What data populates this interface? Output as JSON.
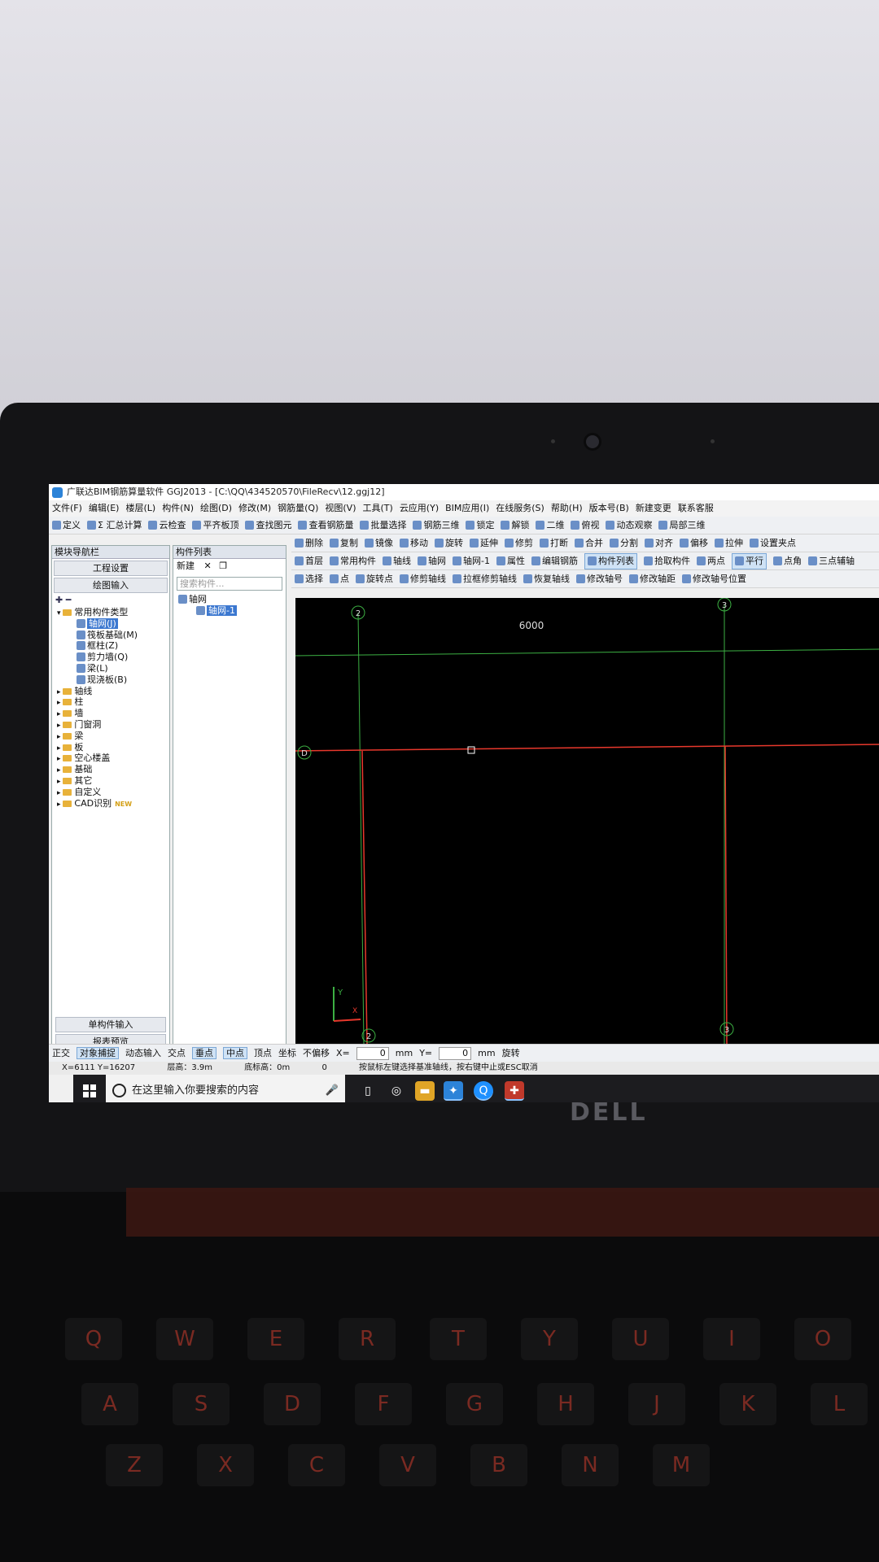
{
  "app": {
    "title": "广联达BIM钢筋算量软件 GGJ2013 - [C:\\QQ\\434520570\\FileRecv\\12.ggj12]"
  },
  "menu": [
    "文件(F)",
    "编辑(E)",
    "楼层(L)",
    "构件(N)",
    "绘图(D)",
    "修改(M)",
    "钢筋量(Q)",
    "视图(V)",
    "工具(T)",
    "云应用(Y)",
    "BIM应用(I)",
    "在线服务(S)",
    "帮助(H)",
    "版本号(B)",
    "新建变更",
    "联系客服"
  ],
  "toolbar1": [
    "定义",
    "Σ 汇总计算",
    "云检查",
    "平齐板顶",
    "查找图元",
    "查看钢筋量",
    "批量选择",
    "钢筋三维",
    "锁定",
    "解锁",
    "二维",
    "俯视",
    "动态观察",
    "局部三维"
  ],
  "toolbar2": [
    "删除",
    "复制",
    "镜像",
    "移动",
    "旋转",
    "延伸",
    "修剪",
    "打断",
    "合并",
    "分割",
    "对齐",
    "偏移",
    "拉伸",
    "设置夹点"
  ],
  "toolbar3": [
    "首层",
    "常用构件",
    "轴线",
    "轴网",
    "轴网-1",
    "属性",
    "编辑钢筋",
    "构件列表",
    "拾取构件",
    "两点",
    "平行",
    "点角",
    "三点辅轴"
  ],
  "toolbar4": [
    "选择",
    "点",
    "旋转点",
    "修剪轴线",
    "拉框修剪轴线",
    "恢复轴线",
    "修改轴号",
    "修改轴距",
    "修改轴号位置"
  ],
  "nav_panel": {
    "title": "模块导航栏",
    "buttons": [
      "工程设置",
      "绘图输入"
    ],
    "tree": [
      {
        "label": "常用构件类型",
        "level": 0,
        "type": "folder"
      },
      {
        "label": "轴网(J)",
        "level": 1,
        "type": "item",
        "selected": true
      },
      {
        "label": "筏板基础(M)",
        "level": 1,
        "type": "item"
      },
      {
        "label": "框柱(Z)",
        "level": 1,
        "type": "item"
      },
      {
        "label": "剪力墙(Q)",
        "level": 1,
        "type": "item"
      },
      {
        "label": "梁(L)",
        "level": 1,
        "type": "item"
      },
      {
        "label": "现浇板(B)",
        "level": 1,
        "type": "item"
      },
      {
        "label": "轴线",
        "level": 0,
        "type": "folder"
      },
      {
        "label": "柱",
        "level": 0,
        "type": "folder"
      },
      {
        "label": "墙",
        "level": 0,
        "type": "folder"
      },
      {
        "label": "门窗洞",
        "level": 0,
        "type": "folder"
      },
      {
        "label": "梁",
        "level": 0,
        "type": "folder"
      },
      {
        "label": "板",
        "level": 0,
        "type": "folder"
      },
      {
        "label": "空心楼盖",
        "level": 0,
        "type": "folder"
      },
      {
        "label": "基础",
        "level": 0,
        "type": "folder"
      },
      {
        "label": "其它",
        "level": 0,
        "type": "folder"
      },
      {
        "label": "自定义",
        "level": 0,
        "type": "folder"
      },
      {
        "label": "CAD识别",
        "level": 0,
        "type": "folder",
        "badge": "NEW"
      }
    ],
    "bottom_buttons": [
      "单构件输入",
      "报表预览"
    ]
  },
  "component_panel": {
    "title": "构件列表",
    "new_label": "新建",
    "search_placeholder": "搜索构件...",
    "tree": [
      {
        "label": "轴网",
        "level": 0
      },
      {
        "label": "轴网-1",
        "level": 1,
        "selected": true
      }
    ]
  },
  "canvas": {
    "dimension_label": "6000",
    "axis_labels": [
      "2",
      "3",
      "D",
      "2",
      "3"
    ],
    "ucs": {
      "x": "X",
      "y": "Y"
    }
  },
  "statusbar": [
    "正交",
    "对象捕捉",
    "动态输入",
    "交点",
    "垂点",
    "中点",
    "顶点",
    "坐标",
    "不偏移",
    "X=",
    "0",
    "mm",
    "Y=",
    "0",
    "mm",
    "旋转"
  ],
  "infobar": {
    "coords": "X=6111 Y=16207",
    "floor_height": "层高：3.9m",
    "base_height": "底标高：0m",
    "zero": "0",
    "hint": "按鼠标左键选择基准轴线，按右键中止或ESC取消"
  },
  "taskbar": {
    "search_text": "在这里输入你要搜索的内容"
  },
  "laptop": {
    "brand": "DELL",
    "keys": [
      "Q",
      "W",
      "E",
      "R",
      "T",
      "Y",
      "U",
      "I",
      "O",
      "A",
      "S",
      "D",
      "F",
      "G",
      "H",
      "J",
      "K",
      "L",
      "Z",
      "X",
      "C",
      "V",
      "B",
      "N",
      "M"
    ]
  }
}
